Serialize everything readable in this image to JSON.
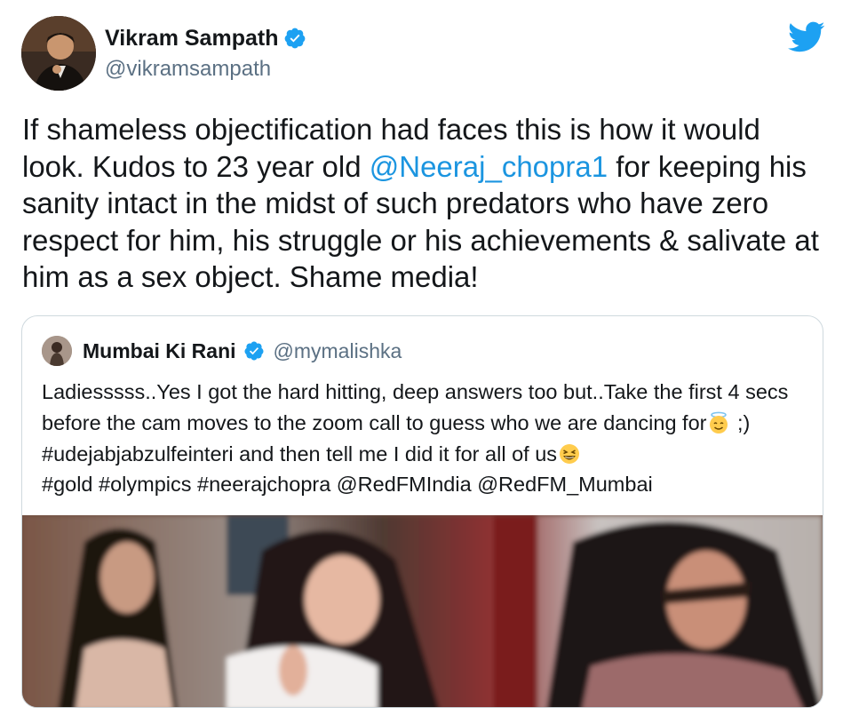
{
  "tweet": {
    "author_name": "Vikram Sampath",
    "author_handle": "@vikramsampath",
    "text_parts": {
      "p1": "If shameless objectification had faces this is how it would look. Kudos to 23 year old ",
      "mention": "@Neeraj_chopra1",
      "p2": " for keeping his sanity intact in the midst of such predators who have zero respect for him, his struggle or his achievements & salivate at him as a sex object. Shame media!"
    }
  },
  "quoted": {
    "author_name": "Mumbai Ki Rani",
    "author_handle": "@mymalishka",
    "text_parts": {
      "p1": "Ladiesssss..Yes I got the hard hitting, deep answers too but..Take the first 4 secs before the cam moves to the zoom call to guess who we are dancing for",
      "p2": " ;) #udejabjabzulfeinteri and then tell me I did it for all of us",
      "p3": "#gold #olympics #neerajchopra @RedFMIndia @RedFM_Mumbai"
    },
    "emojis": [
      "smiling-face-with-halo",
      "grinning-squinting-face"
    ]
  },
  "icons": {
    "verified": "verified-badge-icon",
    "brand": "twitter-bird-icon"
  },
  "colors": {
    "link": "#1b95e0",
    "secondary_text": "#5b7083",
    "twitter_blue": "#1da1f2",
    "border": "#cfd9de"
  }
}
